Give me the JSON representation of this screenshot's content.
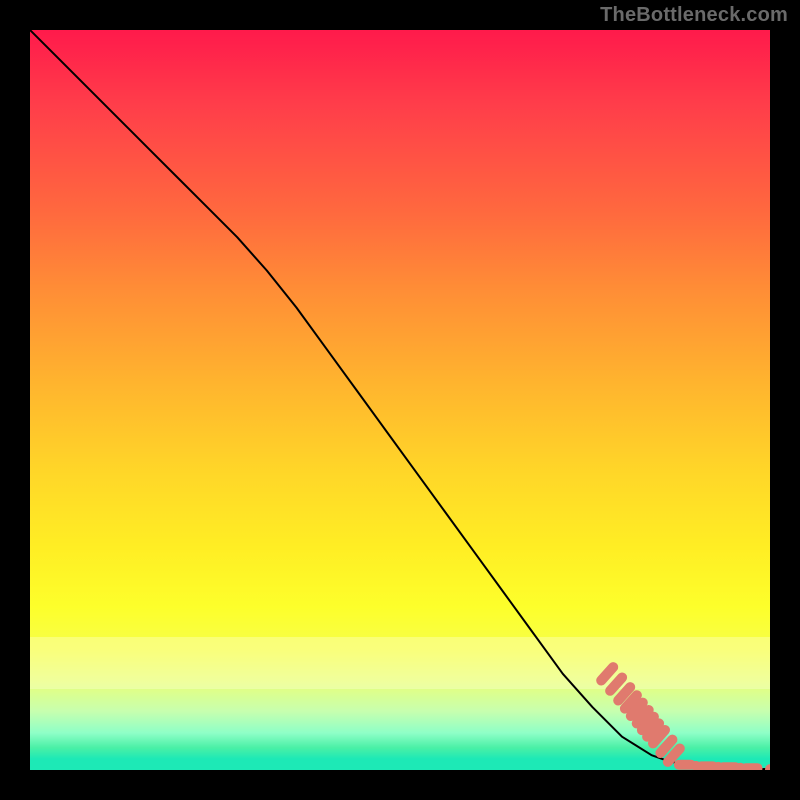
{
  "watermark": "TheBottleneck.com",
  "colors": {
    "frame_bg": "#000000",
    "line": "#000000",
    "marker": "#e07a6e",
    "gradient_top": "#ff1a4b",
    "gradient_bottom": "#1de9b6",
    "watermark_text": "#6a6a6a"
  },
  "chart_data": {
    "type": "line",
    "title": "",
    "xlabel": "",
    "ylabel": "",
    "xlim": [
      0,
      100
    ],
    "ylim": [
      0,
      100
    ],
    "grid": false,
    "legend": false,
    "note": "values estimated from pixel positions; no axis tick labels are rendered in the image",
    "series": [
      {
        "name": "curve",
        "type": "line",
        "x": [
          0,
          4,
          8,
          12,
          16,
          20,
          24,
          28,
          32,
          36,
          40,
          44,
          48,
          52,
          56,
          60,
          64,
          68,
          72,
          76,
          80,
          84,
          86,
          88,
          90,
          92,
          94,
          96,
          98,
          100
        ],
        "y": [
          100,
          96,
          92,
          88,
          84,
          80,
          76,
          72,
          67.5,
          62.5,
          57,
          51.5,
          46,
          40.5,
          35,
          29.5,
          24,
          18.5,
          13,
          8.5,
          4.5,
          2,
          1.3,
          0.8,
          0.55,
          0.4,
          0.3,
          0.22,
          0.15,
          0.12
        ]
      },
      {
        "name": "markers-diagonal",
        "type": "scatter",
        "x": [
          78,
          79.2,
          80.3,
          81.2,
          82,
          82.8,
          83.5,
          84.2,
          85,
          86,
          87
        ],
        "y": [
          13,
          11.6,
          10.3,
          9.2,
          8.2,
          7.2,
          6.3,
          5.4,
          4.5,
          3.2,
          2.0
        ]
      },
      {
        "name": "markers-floor",
        "type": "scatter",
        "x": [
          88.5,
          90,
          91.5,
          93,
          94.5,
          96,
          97.5,
          100
        ],
        "y": [
          0.7,
          0.55,
          0.48,
          0.42,
          0.36,
          0.3,
          0.24,
          0.12
        ]
      }
    ]
  }
}
